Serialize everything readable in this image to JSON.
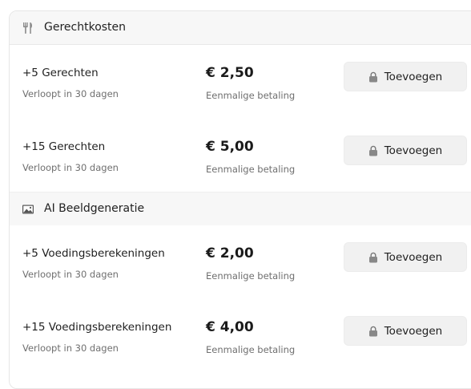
{
  "sections": [
    {
      "title": "Gerechtkosten",
      "icon": "utensils-icon",
      "items": [
        {
          "title": "+5 Gerechten",
          "subtitle": "Verloopt in 30 dagen",
          "price": "€ 2,50",
          "price_note": "Eenmalige betaling",
          "button_label": "Toevoegen"
        },
        {
          "title": "+15 Gerechten",
          "subtitle": "Verloopt in 30 dagen",
          "price": "€ 5,00",
          "price_note": "Eenmalige betaling",
          "button_label": "Toevoegen"
        }
      ]
    },
    {
      "title": "AI Beeldgeneratie",
      "icon": "image-icon",
      "items": [
        {
          "title": "+5 Voedingsberekeningen",
          "subtitle": "Verloopt in 30 dagen",
          "price": "€ 2,00",
          "price_note": "Eenmalige betaling",
          "button_label": "Toevoegen"
        },
        {
          "title": "+15 Voedingsberekeningen",
          "subtitle": "Verloopt in 30 dagen",
          "price": "€ 4,00",
          "price_note": "Eenmalige betaling",
          "button_label": "Toevoegen"
        }
      ]
    }
  ],
  "colors": {
    "button_bg": "#f1f1f1",
    "header_bg": "#f7f7f7",
    "muted_text": "#6f6f6f",
    "icon": "#8a8a8a"
  }
}
